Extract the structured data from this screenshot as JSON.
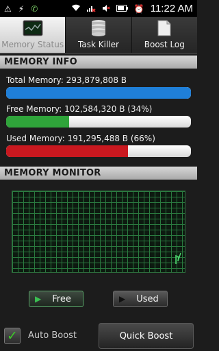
{
  "status_bar": {
    "icons_left": [
      "alert-icon",
      "usb-icon",
      "phone-icon"
    ],
    "icons_right": [
      "wifi-icon",
      "no-signal-icon",
      "mute-icon",
      "battery-icon",
      "alarm-icon"
    ],
    "time": "11:22 AM"
  },
  "tabs": [
    {
      "label": "Memory Status",
      "icon": "memory-chart-icon",
      "active": true
    },
    {
      "label": "Task Killer",
      "icon": "database-icon",
      "active": false
    },
    {
      "label": "Boost Log",
      "icon": "document-icon",
      "active": false
    }
  ],
  "memory_info": {
    "header": "MEMORY INFO",
    "total": {
      "label": "Total Memory: 293,879,808 B",
      "fill_fraction": 1.0,
      "color": "#1f7fd8"
    },
    "free": {
      "label": "Free Memory: 102,584,320 B (34%)",
      "fill_fraction": 0.34,
      "color": "#2fa43a"
    },
    "used": {
      "label": "Used Memory: 191,295,488 B (66%)",
      "fill_fraction": 0.66,
      "color": "#c9181f"
    }
  },
  "memory_monitor": {
    "header": "MEMORY MONITOR",
    "legend": [
      {
        "label": "Free",
        "selected": true,
        "arrow_color": "#3bbf52"
      },
      {
        "label": "Used",
        "selected": false,
        "arrow_color": "#111111"
      }
    ]
  },
  "bottom": {
    "auto_boost_label": "Auto Boost",
    "auto_boost_checked": true,
    "quick_boost_label": "Quick Boost"
  }
}
